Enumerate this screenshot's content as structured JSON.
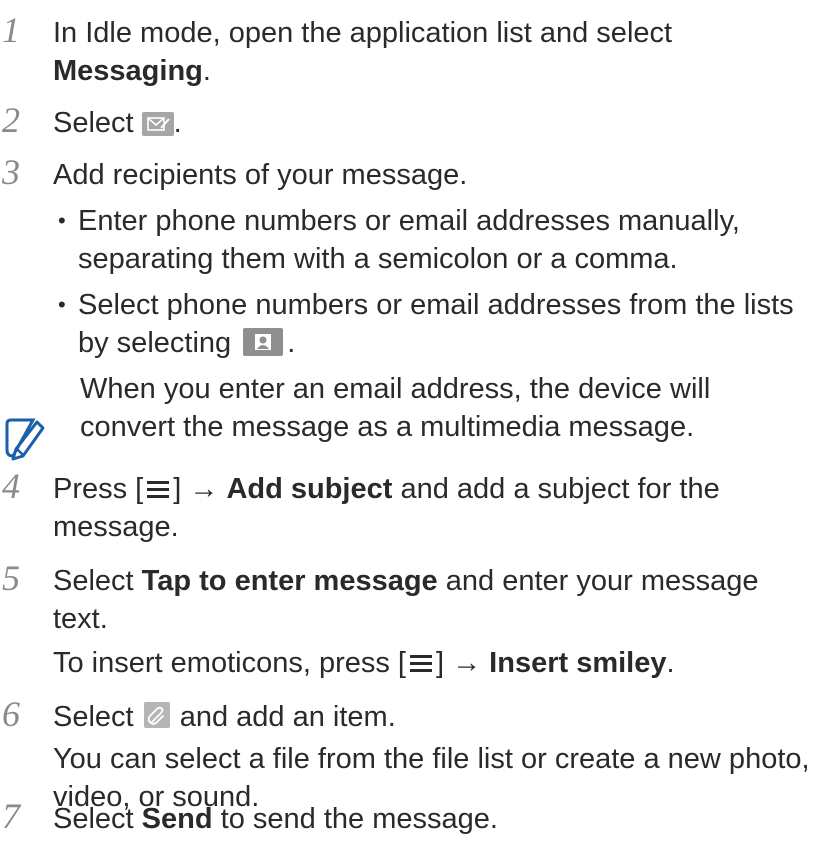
{
  "steps": [
    {
      "num": "1",
      "lines": [
        "In Idle mode, open the application list and select",
        "Messaging",
        "."
      ]
    },
    {
      "num": "2",
      "before": "Select",
      "after": "."
    },
    {
      "num": "3",
      "text": "Add recipients of your message."
    },
    {
      "num": "4",
      "before": "Press [",
      "after": "] →",
      "bold": "Add subject",
      "rest": "and add a subject for the",
      "line2": "message."
    },
    {
      "num": "5",
      "before": "Select",
      "bold": "Tap to enter message",
      "rest": "and enter your message",
      "line2": "text.",
      "extra_before": "To insert emoticons, press [",
      "extra_after": "] →",
      "extra_bold": "Insert smiley",
      "extra_end": "."
    },
    {
      "num": "6",
      "before": "Select",
      "after": "and add an item.",
      "line2": "You can select a file from the file list or create a new photo,",
      "line3": "video, or sound."
    },
    {
      "num": "7",
      "before": "Select",
      "bold": "Send",
      "after": "to send the message."
    }
  ],
  "bullets": [
    {
      "line1": "Enter phone numbers or email addresses manually,",
      "line2": "separating them with a semicolon or a comma."
    },
    {
      "line1": "Select phone numbers or email addresses from the lists",
      "line2_before": "by selecting",
      "line2_after": "."
    }
  ],
  "note": {
    "line1": "When you enter an email address, the device will",
    "line2": "convert the message as a multimedia message."
  },
  "bullet_char": "•",
  "icons": [
    "compose-envelope-icon",
    "contacts-icon",
    "note-pencil-icon",
    "menu-key-icon",
    "paperclip-icon"
  ],
  "colors": {
    "text": "#2a2a2a",
    "step_number": "#8a8a8a",
    "note_icon": "#1a5fa8"
  }
}
